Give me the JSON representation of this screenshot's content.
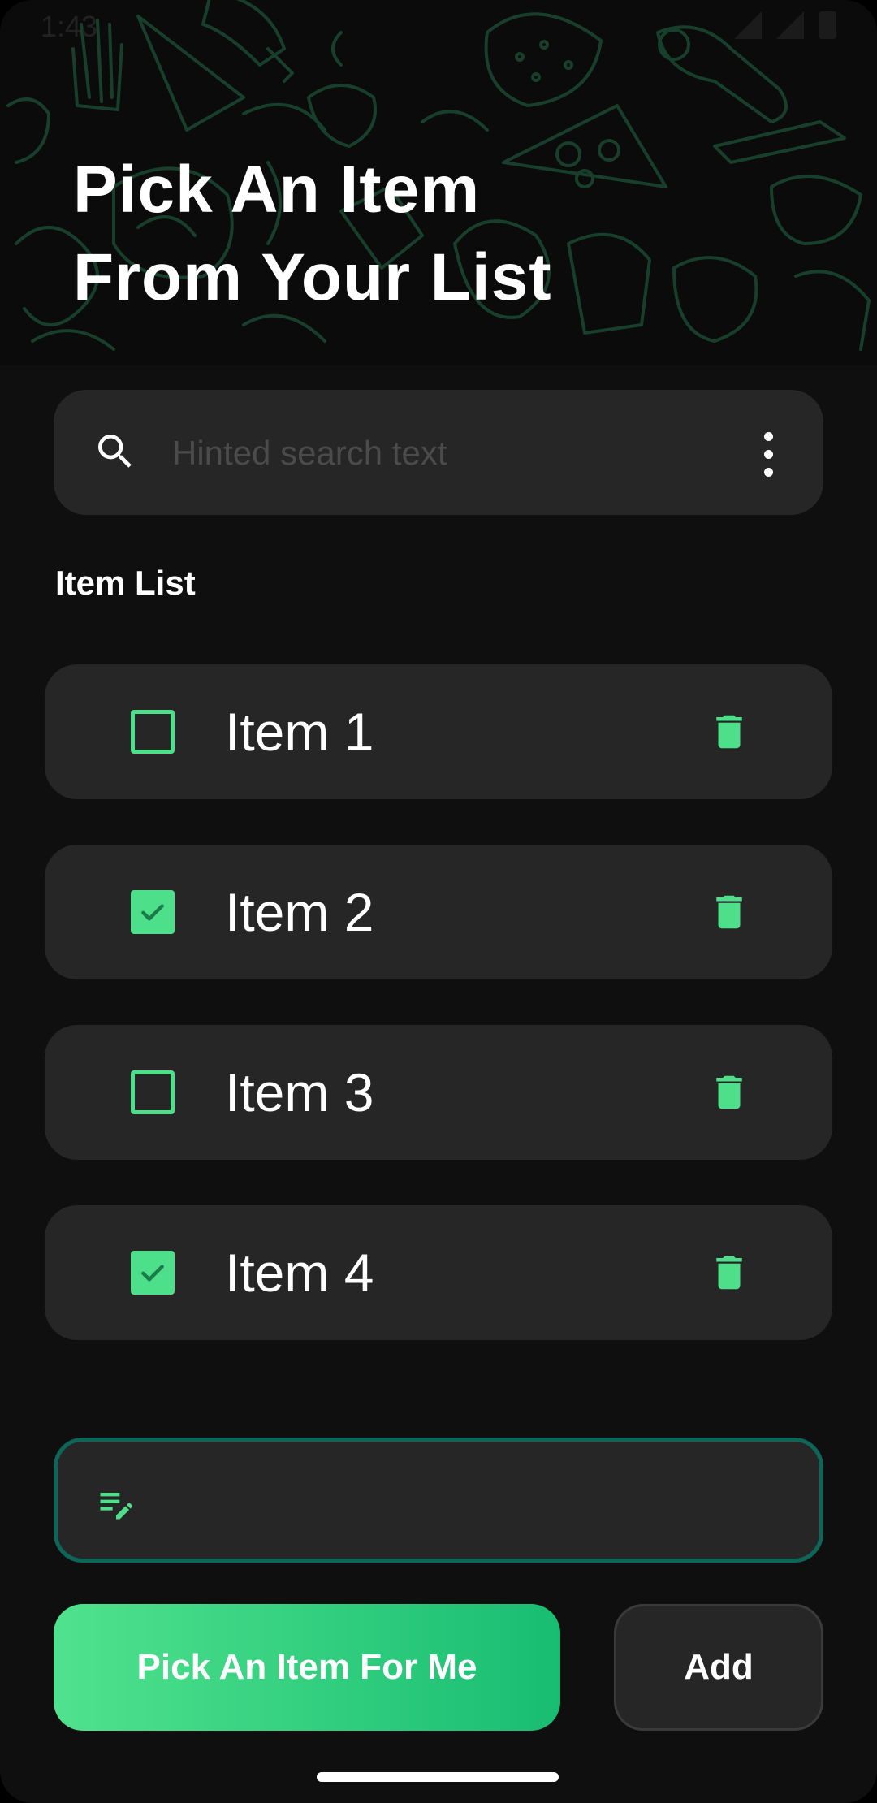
{
  "status_bar": {
    "time": "1:43"
  },
  "header": {
    "title_lines": [
      "Pick An Item",
      "From Your List"
    ]
  },
  "search": {
    "placeholder": "Hinted search text",
    "icon": "search-icon",
    "menu_icon": "more-vert-icon"
  },
  "list": {
    "heading": "Item List",
    "items": [
      {
        "label": "Item 1",
        "checked": false
      },
      {
        "label": "Item 2",
        "checked": true
      },
      {
        "label": "Item 3",
        "checked": false
      },
      {
        "label": "Item 4",
        "checked": true
      }
    ]
  },
  "entry": {
    "icon": "edit-note-icon",
    "value": ""
  },
  "actions": {
    "pick_label": "Pick An Item For Me",
    "add_label": "Add"
  },
  "colors": {
    "accent": "#4ddf8a",
    "background": "#0f0f0f",
    "card": "#262626",
    "entry_border": "#0e6658"
  }
}
